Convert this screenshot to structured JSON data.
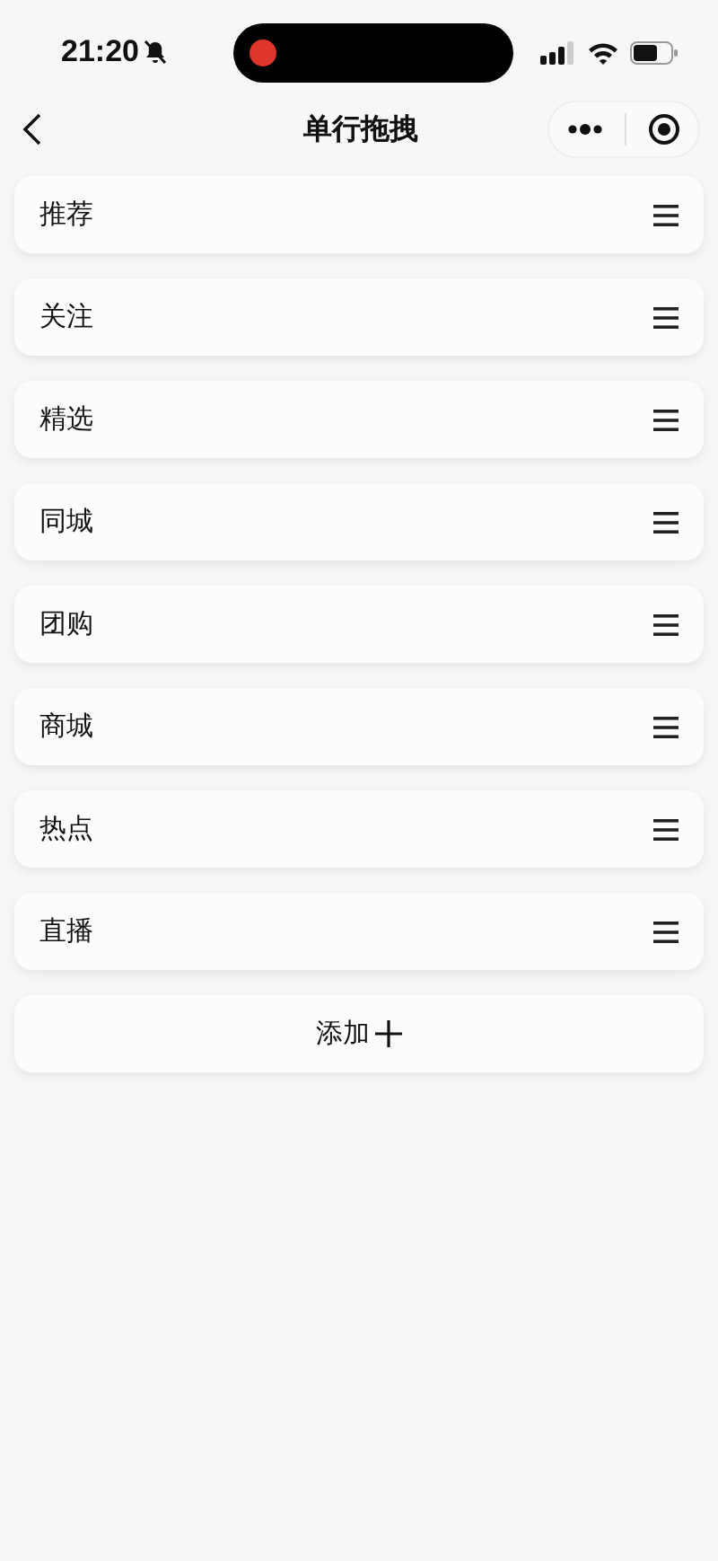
{
  "status_bar": {
    "time": "21:20"
  },
  "nav": {
    "title": "单行拖拽"
  },
  "items": [
    {
      "label": "推荐"
    },
    {
      "label": "关注"
    },
    {
      "label": "精选"
    },
    {
      "label": "同城"
    },
    {
      "label": "团购"
    },
    {
      "label": "商城"
    },
    {
      "label": "热点"
    },
    {
      "label": "直播"
    }
  ],
  "add_button": {
    "label": "添加"
  }
}
